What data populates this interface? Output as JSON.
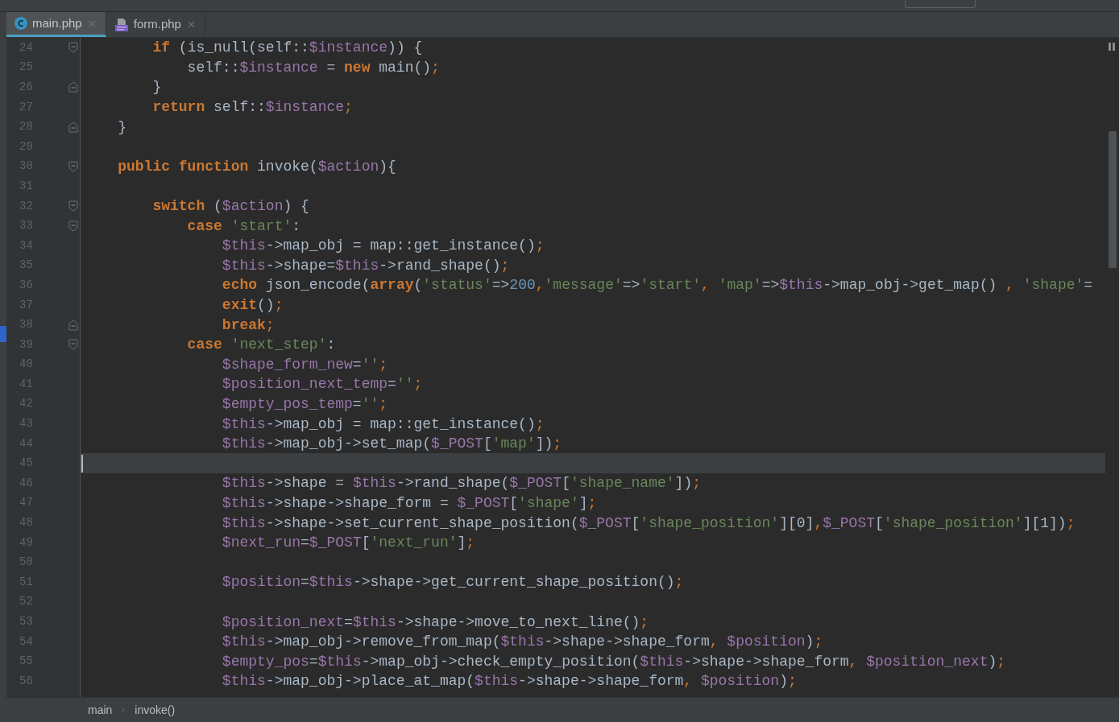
{
  "tabs": [
    {
      "label": "main.php",
      "selected": true,
      "kind": "class"
    },
    {
      "label": "form.php",
      "selected": false,
      "kind": "php"
    }
  ],
  "editor": {
    "lines": [
      {
        "number": "24",
        "current": false,
        "fold": {
          "kind": "start"
        },
        "tokens": [
          {
            "kind": "keyword",
            "text": "        if"
          },
          {
            "kind": "plain",
            "text": " (is_null(self::"
          },
          {
            "kind": "variable",
            "text": "$instance"
          },
          {
            "kind": "plain",
            "text": ")) {"
          }
        ]
      },
      {
        "number": "25",
        "current": false,
        "tokens": [
          {
            "kind": "plain",
            "text": "            self::"
          },
          {
            "kind": "variable",
            "text": "$instance"
          },
          {
            "kind": "plain",
            "text": " = "
          },
          {
            "kind": "keyword",
            "text": "new"
          },
          {
            "kind": "plain",
            "text": " main()"
          },
          {
            "kind": "punct",
            "text": ";"
          }
        ]
      },
      {
        "number": "26",
        "current": false,
        "fold": {
          "kind": "end"
        },
        "tokens": [
          {
            "kind": "plain",
            "text": "        }"
          }
        ]
      },
      {
        "number": "27",
        "current": false,
        "tokens": [
          {
            "kind": "keyword",
            "text": "        return"
          },
          {
            "kind": "plain",
            "text": " self::"
          },
          {
            "kind": "variable",
            "text": "$instance"
          },
          {
            "kind": "punct",
            "text": ";"
          }
        ]
      },
      {
        "number": "28",
        "current": false,
        "fold": {
          "kind": "end"
        },
        "tokens": [
          {
            "kind": "plain",
            "text": "    }"
          }
        ]
      },
      {
        "number": "29",
        "current": false
      },
      {
        "number": "30",
        "current": false,
        "fold": {
          "kind": "start"
        },
        "tokens": [
          {
            "kind": "keyword",
            "text": "    public function"
          },
          {
            "kind": "plain",
            "text": " invoke("
          },
          {
            "kind": "variable",
            "text": "$action"
          },
          {
            "kind": "plain",
            "text": "){"
          }
        ]
      },
      {
        "number": "31",
        "current": false
      },
      {
        "number": "32",
        "current": false,
        "fold": {
          "kind": "start"
        },
        "tokens": [
          {
            "kind": "keyword",
            "text": "        switch"
          },
          {
            "kind": "plain",
            "text": " ("
          },
          {
            "kind": "variable",
            "text": "$action"
          },
          {
            "kind": "plain",
            "text": ") {"
          }
        ]
      },
      {
        "number": "33",
        "current": false,
        "fold": {
          "kind": "start"
        },
        "tokens": [
          {
            "kind": "keyword",
            "text": "            case "
          },
          {
            "kind": "string",
            "text": "'start'"
          },
          {
            "kind": "plain",
            "text": ":"
          }
        ]
      },
      {
        "number": "34",
        "current": false,
        "tokens": [
          {
            "kind": "variable",
            "text": "                $this"
          },
          {
            "kind": "plain",
            "text": "->map_obj = map::get_instance()"
          },
          {
            "kind": "punct",
            "text": ";"
          }
        ]
      },
      {
        "number": "35",
        "current": false,
        "tokens": [
          {
            "kind": "variable",
            "text": "                $this"
          },
          {
            "kind": "plain",
            "text": "->shape="
          },
          {
            "kind": "variable",
            "text": "$this"
          },
          {
            "kind": "plain",
            "text": "->rand_shape()"
          },
          {
            "kind": "punct",
            "text": ";"
          }
        ]
      },
      {
        "number": "36",
        "current": false,
        "tokens": [
          {
            "kind": "keyword",
            "text": "                echo"
          },
          {
            "kind": "plain",
            "text": " json_encode("
          },
          {
            "kind": "keyword",
            "text": "array"
          },
          {
            "kind": "plain",
            "text": "("
          },
          {
            "kind": "string",
            "text": "'status'"
          },
          {
            "kind": "plain",
            "text": "=>"
          },
          {
            "kind": "number",
            "text": "200"
          },
          {
            "kind": "punct",
            "text": ","
          },
          {
            "kind": "string",
            "text": "'message'"
          },
          {
            "kind": "plain",
            "text": "=>"
          },
          {
            "kind": "string",
            "text": "'start'"
          },
          {
            "kind": "punct",
            "text": ", "
          },
          {
            "kind": "string",
            "text": "'map'"
          },
          {
            "kind": "plain",
            "text": "=>"
          },
          {
            "kind": "variable",
            "text": "$this"
          },
          {
            "kind": "plain",
            "text": "->map_obj->get_map() "
          },
          {
            "kind": "punct",
            "text": ", "
          },
          {
            "kind": "string",
            "text": "'shape'"
          },
          {
            "kind": "plain",
            "text": "="
          }
        ]
      },
      {
        "number": "37",
        "current": false,
        "tokens": [
          {
            "kind": "keyword",
            "text": "                exit"
          },
          {
            "kind": "plain",
            "text": "()"
          },
          {
            "kind": "punct",
            "text": ";"
          }
        ]
      },
      {
        "number": "38",
        "current": false,
        "fold": {
          "kind": "end"
        },
        "tokens": [
          {
            "kind": "keyword",
            "text": "                break"
          },
          {
            "kind": "punct",
            "text": ";"
          }
        ]
      },
      {
        "number": "39",
        "current": false,
        "fold": {
          "kind": "start"
        },
        "tokens": [
          {
            "kind": "keyword",
            "text": "            case "
          },
          {
            "kind": "string",
            "text": "'next_step'"
          },
          {
            "kind": "plain",
            "text": ":"
          }
        ]
      },
      {
        "number": "40",
        "current": false,
        "tokens": [
          {
            "kind": "variable",
            "text": "                $shape_form_new"
          },
          {
            "kind": "plain",
            "text": "="
          },
          {
            "kind": "string",
            "text": "''"
          },
          {
            "kind": "punct",
            "text": ";"
          }
        ]
      },
      {
        "number": "41",
        "current": false,
        "tokens": [
          {
            "kind": "variable",
            "text": "                $position_next_temp"
          },
          {
            "kind": "plain",
            "text": "="
          },
          {
            "kind": "string",
            "text": "''"
          },
          {
            "kind": "punct",
            "text": ";"
          }
        ]
      },
      {
        "number": "42",
        "current": false,
        "tokens": [
          {
            "kind": "variable",
            "text": "                $empty_pos_temp"
          },
          {
            "kind": "plain",
            "text": "="
          },
          {
            "kind": "string",
            "text": "''"
          },
          {
            "kind": "punct",
            "text": ";"
          }
        ]
      },
      {
        "number": "43",
        "current": false,
        "tokens": [
          {
            "kind": "variable",
            "text": "                $this"
          },
          {
            "kind": "plain",
            "text": "->map_obj = map::get_instance()"
          },
          {
            "kind": "punct",
            "text": ";"
          }
        ]
      },
      {
        "number": "44",
        "current": false,
        "tokens": [
          {
            "kind": "variable",
            "text": "                $this"
          },
          {
            "kind": "plain",
            "text": "->map_obj->set_map("
          },
          {
            "kind": "variable",
            "text": "$_POST"
          },
          {
            "kind": "plain",
            "text": "["
          },
          {
            "kind": "string",
            "text": "'map'"
          },
          {
            "kind": "plain",
            "text": "])"
          },
          {
            "kind": "punct",
            "text": ";"
          }
        ]
      },
      {
        "number": "45",
        "current": true
      },
      {
        "number": "46",
        "current": false,
        "tokens": [
          {
            "kind": "variable",
            "text": "                $this"
          },
          {
            "kind": "plain",
            "text": "->shape = "
          },
          {
            "kind": "variable",
            "text": "$this"
          },
          {
            "kind": "plain",
            "text": "->rand_shape("
          },
          {
            "kind": "variable",
            "text": "$_POST"
          },
          {
            "kind": "plain",
            "text": "["
          },
          {
            "kind": "string",
            "text": "'shape_name'"
          },
          {
            "kind": "plain",
            "text": "])"
          },
          {
            "kind": "punct",
            "text": ";"
          }
        ]
      },
      {
        "number": "47",
        "current": false,
        "tokens": [
          {
            "kind": "variable",
            "text": "                $this"
          },
          {
            "kind": "plain",
            "text": "->shape->shape_form = "
          },
          {
            "kind": "variable",
            "text": "$_POST"
          },
          {
            "kind": "plain",
            "text": "["
          },
          {
            "kind": "string",
            "text": "'shape'"
          },
          {
            "kind": "plain",
            "text": "]"
          },
          {
            "kind": "punct",
            "text": ";"
          }
        ]
      },
      {
        "number": "48",
        "current": false,
        "tokens": [
          {
            "kind": "variable",
            "text": "                $this"
          },
          {
            "kind": "plain",
            "text": "->shape->set_current_shape_position("
          },
          {
            "kind": "variable",
            "text": "$_POST"
          },
          {
            "kind": "plain",
            "text": "["
          },
          {
            "kind": "string",
            "text": "'shape_position'"
          },
          {
            "kind": "plain",
            "text": "][0]"
          },
          {
            "kind": "punct",
            "text": ","
          },
          {
            "kind": "variable",
            "text": "$_POST"
          },
          {
            "kind": "plain",
            "text": "["
          },
          {
            "kind": "string",
            "text": "'shape_position'"
          },
          {
            "kind": "plain",
            "text": "][1])"
          },
          {
            "kind": "punct",
            "text": ";"
          }
        ]
      },
      {
        "number": "49",
        "current": false,
        "tokens": [
          {
            "kind": "variable",
            "text": "                $next_run"
          },
          {
            "kind": "plain",
            "text": "="
          },
          {
            "kind": "variable",
            "text": "$_POST"
          },
          {
            "kind": "plain",
            "text": "["
          },
          {
            "kind": "string",
            "text": "'next_run'"
          },
          {
            "kind": "plain",
            "text": "]"
          },
          {
            "kind": "punct",
            "text": ";"
          }
        ]
      },
      {
        "number": "50",
        "current": false
      },
      {
        "number": "51",
        "current": false,
        "tokens": [
          {
            "kind": "variable",
            "text": "                $position"
          },
          {
            "kind": "plain",
            "text": "="
          },
          {
            "kind": "variable",
            "text": "$this"
          },
          {
            "kind": "plain",
            "text": "->shape->get_current_shape_position()"
          },
          {
            "kind": "punct",
            "text": ";"
          }
        ]
      },
      {
        "number": "52",
        "current": false
      },
      {
        "number": "53",
        "current": false,
        "tokens": [
          {
            "kind": "variable",
            "text": "                $position_next"
          },
          {
            "kind": "plain",
            "text": "="
          },
          {
            "kind": "variable",
            "text": "$this"
          },
          {
            "kind": "plain",
            "text": "->shape->move_to_next_line()"
          },
          {
            "kind": "punct",
            "text": ";"
          }
        ]
      },
      {
        "number": "54",
        "current": false,
        "tokens": [
          {
            "kind": "variable",
            "text": "                $this"
          },
          {
            "kind": "plain",
            "text": "->map_obj->remove_from_map("
          },
          {
            "kind": "variable",
            "text": "$this"
          },
          {
            "kind": "plain",
            "text": "->shape->shape_form"
          },
          {
            "kind": "punct",
            "text": ", "
          },
          {
            "kind": "variable",
            "text": "$position"
          },
          {
            "kind": "plain",
            "text": ")"
          },
          {
            "kind": "punct",
            "text": ";"
          }
        ]
      },
      {
        "number": "55",
        "current": false,
        "tokens": [
          {
            "kind": "variable",
            "text": "                $empty_pos"
          },
          {
            "kind": "plain",
            "text": "="
          },
          {
            "kind": "variable",
            "text": "$this"
          },
          {
            "kind": "plain",
            "text": "->map_obj->check_empty_position("
          },
          {
            "kind": "variable",
            "text": "$this"
          },
          {
            "kind": "plain",
            "text": "->shape->shape_form"
          },
          {
            "kind": "punct",
            "text": ", "
          },
          {
            "kind": "variable",
            "text": "$position_next"
          },
          {
            "kind": "plain",
            "text": ")"
          },
          {
            "kind": "punct",
            "text": ";"
          }
        ]
      },
      {
        "number": "56",
        "current": false,
        "tokens": [
          {
            "kind": "variable",
            "text": "                $this"
          },
          {
            "kind": "plain",
            "text": "->map_obj->place_at_map("
          },
          {
            "kind": "variable",
            "text": "$this"
          },
          {
            "kind": "plain",
            "text": "->shape->shape_form"
          },
          {
            "kind": "punct",
            "text": ", "
          },
          {
            "kind": "variable",
            "text": "$position"
          },
          {
            "kind": "plain",
            "text": ")"
          },
          {
            "kind": "punct",
            "text": ";"
          }
        ]
      }
    ]
  },
  "breadcrumbs": [
    "main",
    "invoke()"
  ]
}
